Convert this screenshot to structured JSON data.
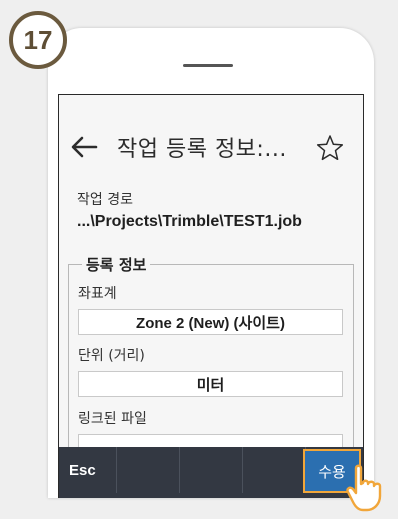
{
  "step_number": "17",
  "header": {
    "title": "작업 등록 정보:..."
  },
  "job_path": {
    "label": "작업 경로",
    "value": "...\\Projects\\Trimble\\TEST1.job"
  },
  "properties_group": {
    "title": "등록 정보",
    "fields": [
      {
        "label": "좌표계",
        "value": "Zone 2 (New) (사이트)"
      },
      {
        "label": "단위 (거리)",
        "value": "미터"
      },
      {
        "label": "링크된 파일",
        "value": ""
      }
    ]
  },
  "toolbar": {
    "esc_label": "Esc",
    "accept_label": "수용"
  },
  "colors": {
    "toolbar_bg": "#333842",
    "accept_bg": "#2b6fb0",
    "highlight": "#f1a63a",
    "badge_border": "#6b5a3e"
  },
  "icons": {
    "back": "arrow-left-icon",
    "favorite": "star-outline-icon",
    "pointer": "hand-pointer-icon"
  }
}
